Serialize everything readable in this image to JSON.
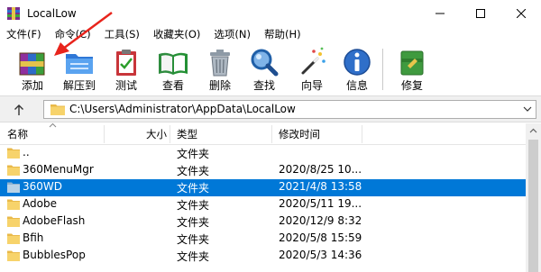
{
  "window": {
    "title": "LocalLow"
  },
  "menu": [
    {
      "label": "文件(F)"
    },
    {
      "label": "命令(C)"
    },
    {
      "label": "工具(S)"
    },
    {
      "label": "收藏夹(O)"
    },
    {
      "label": "选项(N)"
    },
    {
      "label": "帮助(H)"
    }
  ],
  "toolbar": [
    {
      "label": "添加",
      "icon": "add-archive-icon"
    },
    {
      "label": "解压到",
      "icon": "extract-folder-icon"
    },
    {
      "label": "测试",
      "icon": "test-clipboard-icon"
    },
    {
      "label": "查看",
      "icon": "view-book-icon"
    },
    {
      "label": "删除",
      "icon": "delete-trash-icon"
    },
    {
      "label": "查找",
      "icon": "find-magnifier-icon"
    },
    {
      "label": "向导",
      "icon": "wizard-wand-icon"
    },
    {
      "label": "信息",
      "icon": "info-icon"
    },
    {
      "label": "修复",
      "icon": "repair-kit-icon"
    }
  ],
  "address": {
    "path": "C:\\Users\\Administrator\\AppData\\LocalLow"
  },
  "columns": {
    "name": "名称",
    "size": "大小",
    "type": "类型",
    "modified": "修改时间"
  },
  "files": [
    {
      "name": "..",
      "type": "文件夹",
      "modified": "",
      "selected": false
    },
    {
      "name": "360MenuMgr",
      "type": "文件夹",
      "modified": "2020/8/25 10...",
      "selected": false
    },
    {
      "name": "360WD",
      "type": "文件夹",
      "modified": "2021/4/8 13:58",
      "selected": true
    },
    {
      "name": "Adobe",
      "type": "文件夹",
      "modified": "2020/5/11 19...",
      "selected": false
    },
    {
      "name": "AdobeFlash",
      "type": "文件夹",
      "modified": "2020/12/9 8:32",
      "selected": false
    },
    {
      "name": "Bfih",
      "type": "文件夹",
      "modified": "2020/5/8 15:59",
      "selected": false
    },
    {
      "name": "BubblesPop",
      "type": "文件夹",
      "modified": "2020/5/3 14:36",
      "selected": false
    }
  ],
  "colors": {
    "selection": "#0078d7",
    "folder": "#f7d36b",
    "annotation_arrow": "#e8241c"
  }
}
